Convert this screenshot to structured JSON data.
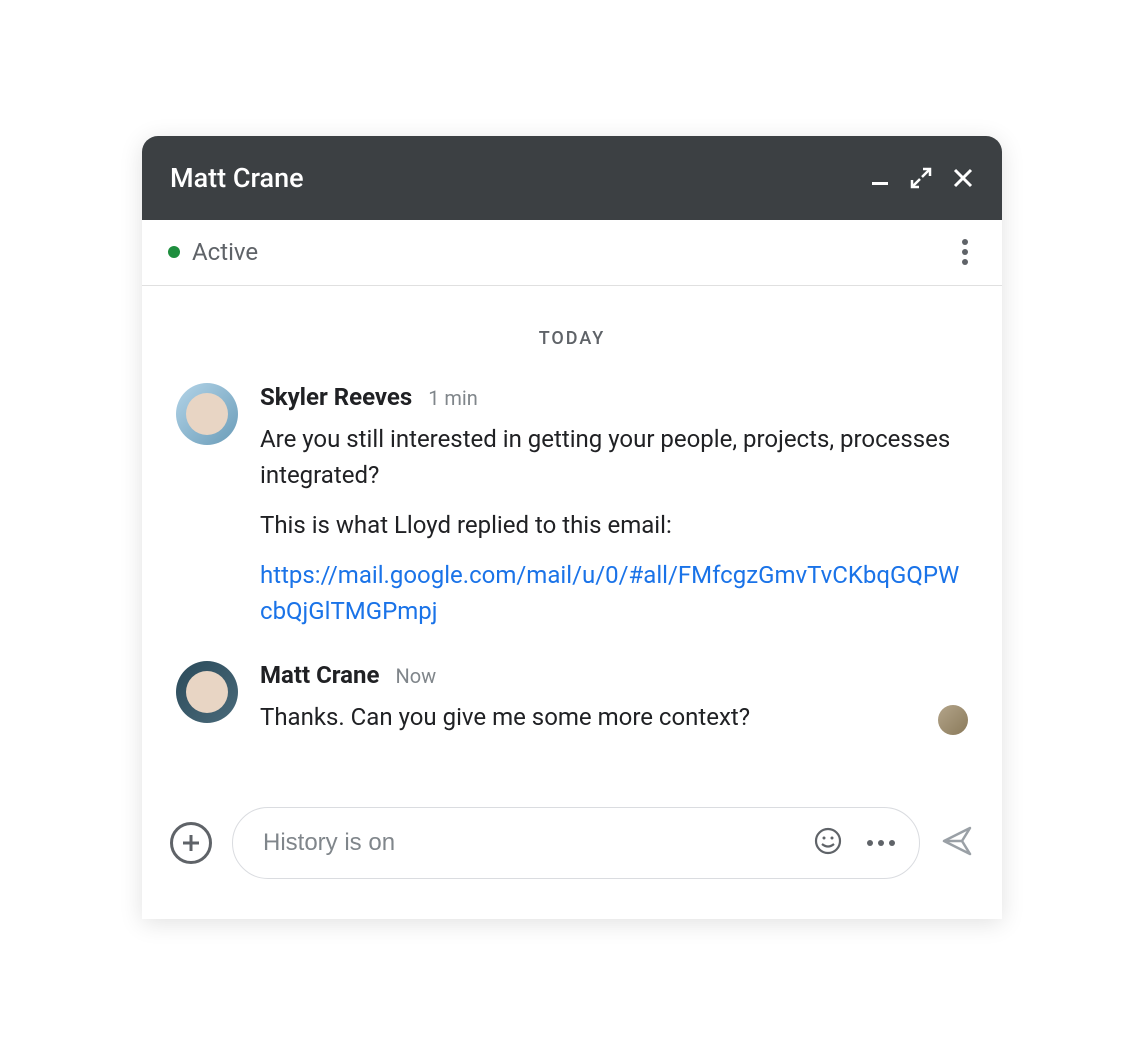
{
  "header": {
    "title": "Matt Crane"
  },
  "status": {
    "text": "Active",
    "color": "#1e8e3e"
  },
  "date_separator": "TODAY",
  "messages": [
    {
      "sender": "Skyler Reeves",
      "timestamp": "1 min",
      "paragraphs": [
        "Are you still interested in getting your people, projects, processes integrated?",
        "This is what Lloyd replied to this email:"
      ],
      "link": "https://mail.google.com/mail/u/0/#all/FMfcgzGmvTvCKbqGQPWcbQjGlTMGPmpj"
    },
    {
      "sender": "Matt Crane",
      "timestamp": "Now",
      "paragraphs": [
        "Thanks. Can you give me some more context?"
      ],
      "read_receipt": true
    }
  ],
  "compose": {
    "placeholder": "History is on"
  }
}
